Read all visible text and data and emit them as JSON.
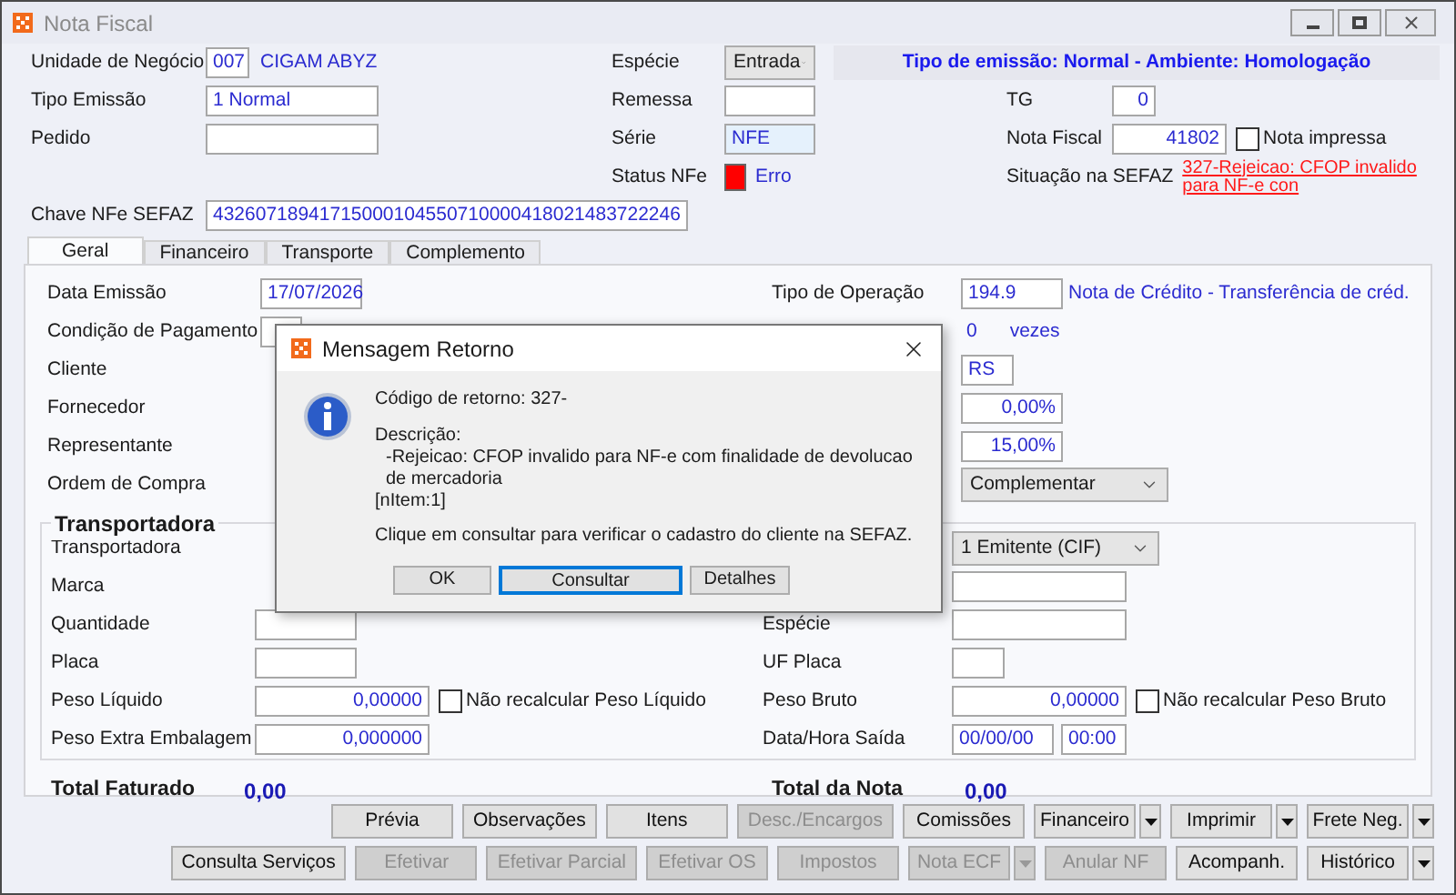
{
  "window": {
    "title": "Nota Fiscal"
  },
  "banner": "Tipo de emissão: Normal - Ambiente: Homologação",
  "unidade_negocio": {
    "label": "Unidade de Negócio",
    "code": "007",
    "name": "CIGAM ABYZ"
  },
  "especie": {
    "label": "Espécie",
    "value": "Entrada"
  },
  "tipo_emissao": {
    "label": "Tipo Emissão",
    "value": "1 Normal"
  },
  "remessa": {
    "label": "Remessa"
  },
  "tg": {
    "label": "TG",
    "value": "0"
  },
  "pedido": {
    "label": "Pedido"
  },
  "serie": {
    "label": "Série",
    "value": "NFE"
  },
  "nota_fiscal": {
    "label": "Nota Fiscal",
    "value": "41802",
    "checkbox": {
      "label": "Nota impressa",
      "checked": false
    }
  },
  "status_nfe": {
    "label": "Status NFe",
    "status": "Erro",
    "error": true
  },
  "situacao_sefaz": {
    "label": "Situação na SEFAZ",
    "value": "327-Rejeicao: CFOP invalido para NF-e con"
  },
  "chave": {
    "label": "Chave NFe SEFAZ",
    "value": "43260718941715000104550710000418021483722246"
  },
  "tabs": [
    {
      "label": "Geral",
      "selected": true
    },
    {
      "label": "Financeiro",
      "selected": false
    },
    {
      "label": "Transporte",
      "selected": false
    },
    {
      "label": "Complemento",
      "selected": false
    }
  ],
  "geral_left": [
    {
      "label": "Data Emissão",
      "field": true,
      "value": "17/07/2026"
    },
    {
      "label": "Condição de Pagamento",
      "field": true
    },
    {
      "label": "Cliente",
      "field": false
    },
    {
      "label": "Fornecedor",
      "field": false
    },
    {
      "label": "Representante",
      "field": false
    },
    {
      "label": "Ordem de Compra",
      "field": false
    }
  ],
  "geral_right": [
    {
      "kind": "field",
      "label": "Tipo de Operação",
      "value": "194.9",
      "description": "Nota de Crédito - Transferência de créd."
    },
    {
      "kind": "count",
      "value": "0",
      "unit": "vezes"
    },
    {
      "kind": "field",
      "value": "RS"
    },
    {
      "kind": "field",
      "value": "0,00%"
    },
    {
      "kind": "field",
      "value": "15,00%"
    },
    {
      "kind": "select",
      "value": "Complementar"
    }
  ],
  "transportadora": {
    "title": "Transportadora",
    "left": [
      {
        "label": "Transportadora",
        "field": false
      },
      {
        "label": "Marca",
        "field": false
      },
      {
        "label": "Quantidade",
        "field": true
      },
      {
        "label": "Placa",
        "field": true
      },
      {
        "label": "Peso Líquido",
        "field": true,
        "value": "0,00000",
        "checkbox": {
          "label": "Não recalcular Peso Líquido",
          "checked": false
        }
      },
      {
        "label": "Peso Extra Embalagem",
        "field": true,
        "value": "0,000000"
      }
    ],
    "right": [
      {
        "kind": "select",
        "value": "1 Emitente (CIF)"
      },
      {
        "kind": "field"
      },
      {
        "kind": "field",
        "label": "Espécie"
      },
      {
        "kind": "field",
        "label": "UF Placa"
      },
      {
        "kind": "field",
        "label": "Peso Bruto",
        "value": "0,00000",
        "checkbox": {
          "label": "Não recalcular Peso Bruto",
          "checked": false
        }
      },
      {
        "kind": "datetime",
        "label": "Data/Hora Saída",
        "date": "00/00/00",
        "time": "00:00"
      }
    ]
  },
  "totals": [
    {
      "label": "Total Faturado",
      "value": "0,00"
    },
    {
      "label": "Total da Nota",
      "value": "0,00"
    }
  ],
  "button_rows": [
    [
      {
        "label": "Prévia",
        "disabled": false,
        "menu": false
      },
      {
        "label": "Observações",
        "disabled": false,
        "menu": false
      },
      {
        "label": "Itens",
        "disabled": false,
        "menu": false
      },
      {
        "label": "Desc./Encargos",
        "disabled": true,
        "menu": false
      },
      {
        "label": "Comissões",
        "disabled": false,
        "menu": false
      },
      {
        "label": "Financeiro",
        "disabled": false,
        "menu": true
      },
      {
        "label": "Imprimir",
        "disabled": false,
        "menu": true
      },
      {
        "label": "Frete Neg.",
        "disabled": false,
        "menu": true
      }
    ],
    [
      {
        "label": "Consulta Serviços",
        "disabled": false,
        "menu": false
      },
      {
        "label": "Efetivar",
        "disabled": true,
        "menu": false
      },
      {
        "label": "Efetivar Parcial",
        "disabled": true,
        "menu": false
      },
      {
        "label": "Efetivar OS",
        "disabled": true,
        "menu": false
      },
      {
        "label": "Impostos",
        "disabled": true,
        "menu": false
      },
      {
        "label": "Nota ECF",
        "disabled": true,
        "menu": true
      },
      {
        "label": "Anular NF",
        "disabled": true,
        "menu": false
      },
      {
        "label": "Acompanh.",
        "disabled": false,
        "menu": false
      },
      {
        "label": "Histórico",
        "disabled": false,
        "menu": true
      }
    ]
  ],
  "dialog": {
    "title": "Mensagem Retorno",
    "code": "Código de retorno: 327-",
    "description_label": "Descrição:",
    "description": [
      "-Rejeicao: CFOP invalido para NF-e com finalidade de devolucao de mercadoria",
      "[nItem:1]"
    ],
    "hint": "Clique em consultar para verificar o cadastro do cliente na SEFAZ.",
    "buttons": [
      {
        "label": "OK",
        "focused": false
      },
      {
        "label": "Consultar",
        "focused": true
      },
      {
        "label": "Detalhes",
        "focused": false
      }
    ]
  }
}
